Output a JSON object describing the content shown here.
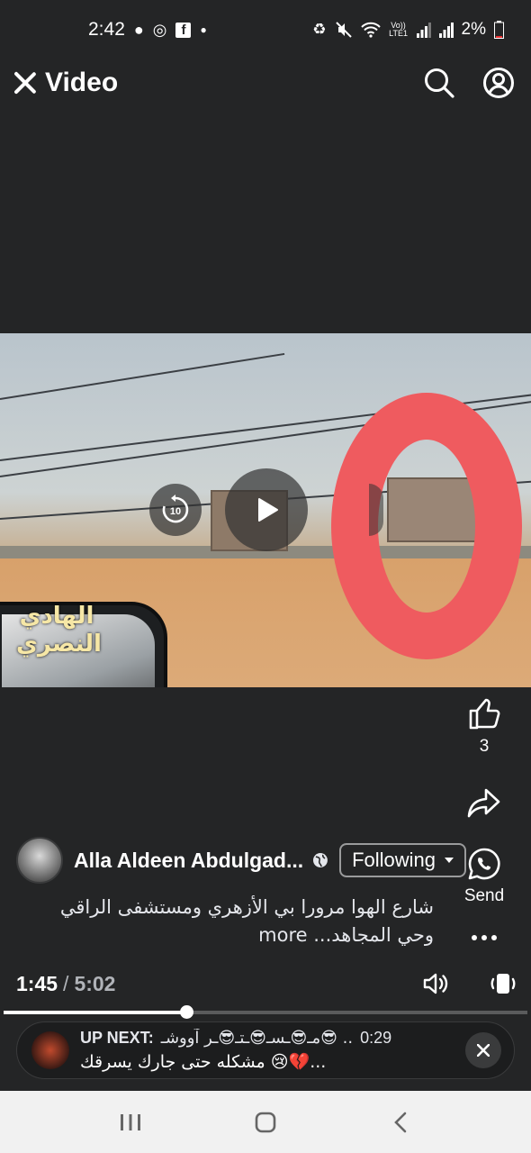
{
  "status_bar": {
    "time": "2:42",
    "battery": "2%",
    "left_icons": [
      "whatsapp-icon",
      "target-icon",
      "facebook-icon",
      "dot-icon"
    ],
    "right_icons": [
      "battery-saver-icon",
      "mute-icon",
      "wifi-icon",
      "volte-icon",
      "signal-icon",
      "signal-r-icon"
    ],
    "volte_label": "Vo)) LTE1"
  },
  "header": {
    "title": "Video",
    "icons": [
      "close-icon",
      "search-icon",
      "profile-icon"
    ]
  },
  "video": {
    "replay_label": "10",
    "watermark": "الهادي النصري",
    "annotation_color": "#ef5b5f"
  },
  "rail": {
    "like_count": "3",
    "send_label": "Send"
  },
  "post": {
    "author": "Alla Aldeen Abdulgad...",
    "follow_label": "Following",
    "caption": "شارع الهوا مرورا بي الأزهري ومستشفى الراقي وحي المجاهد...",
    "more_label": "more"
  },
  "player": {
    "current_time": "1:45",
    "separator": "/",
    "total_time": "5:02",
    "progress_fraction": 0.348
  },
  "up_next": {
    "label": "UP NEXT:",
    "title_line1": "مـ😎ـسـ😎ـتـ😎ـر آووشـ😎 ..",
    "duration": "0:29",
    "title_line2": "مشكله حتى جارك يسرقك 😢💔..."
  },
  "colors": {
    "background": "#242526",
    "annotation": "#ef5b5f",
    "nav_bar": "#f1f1f1"
  }
}
